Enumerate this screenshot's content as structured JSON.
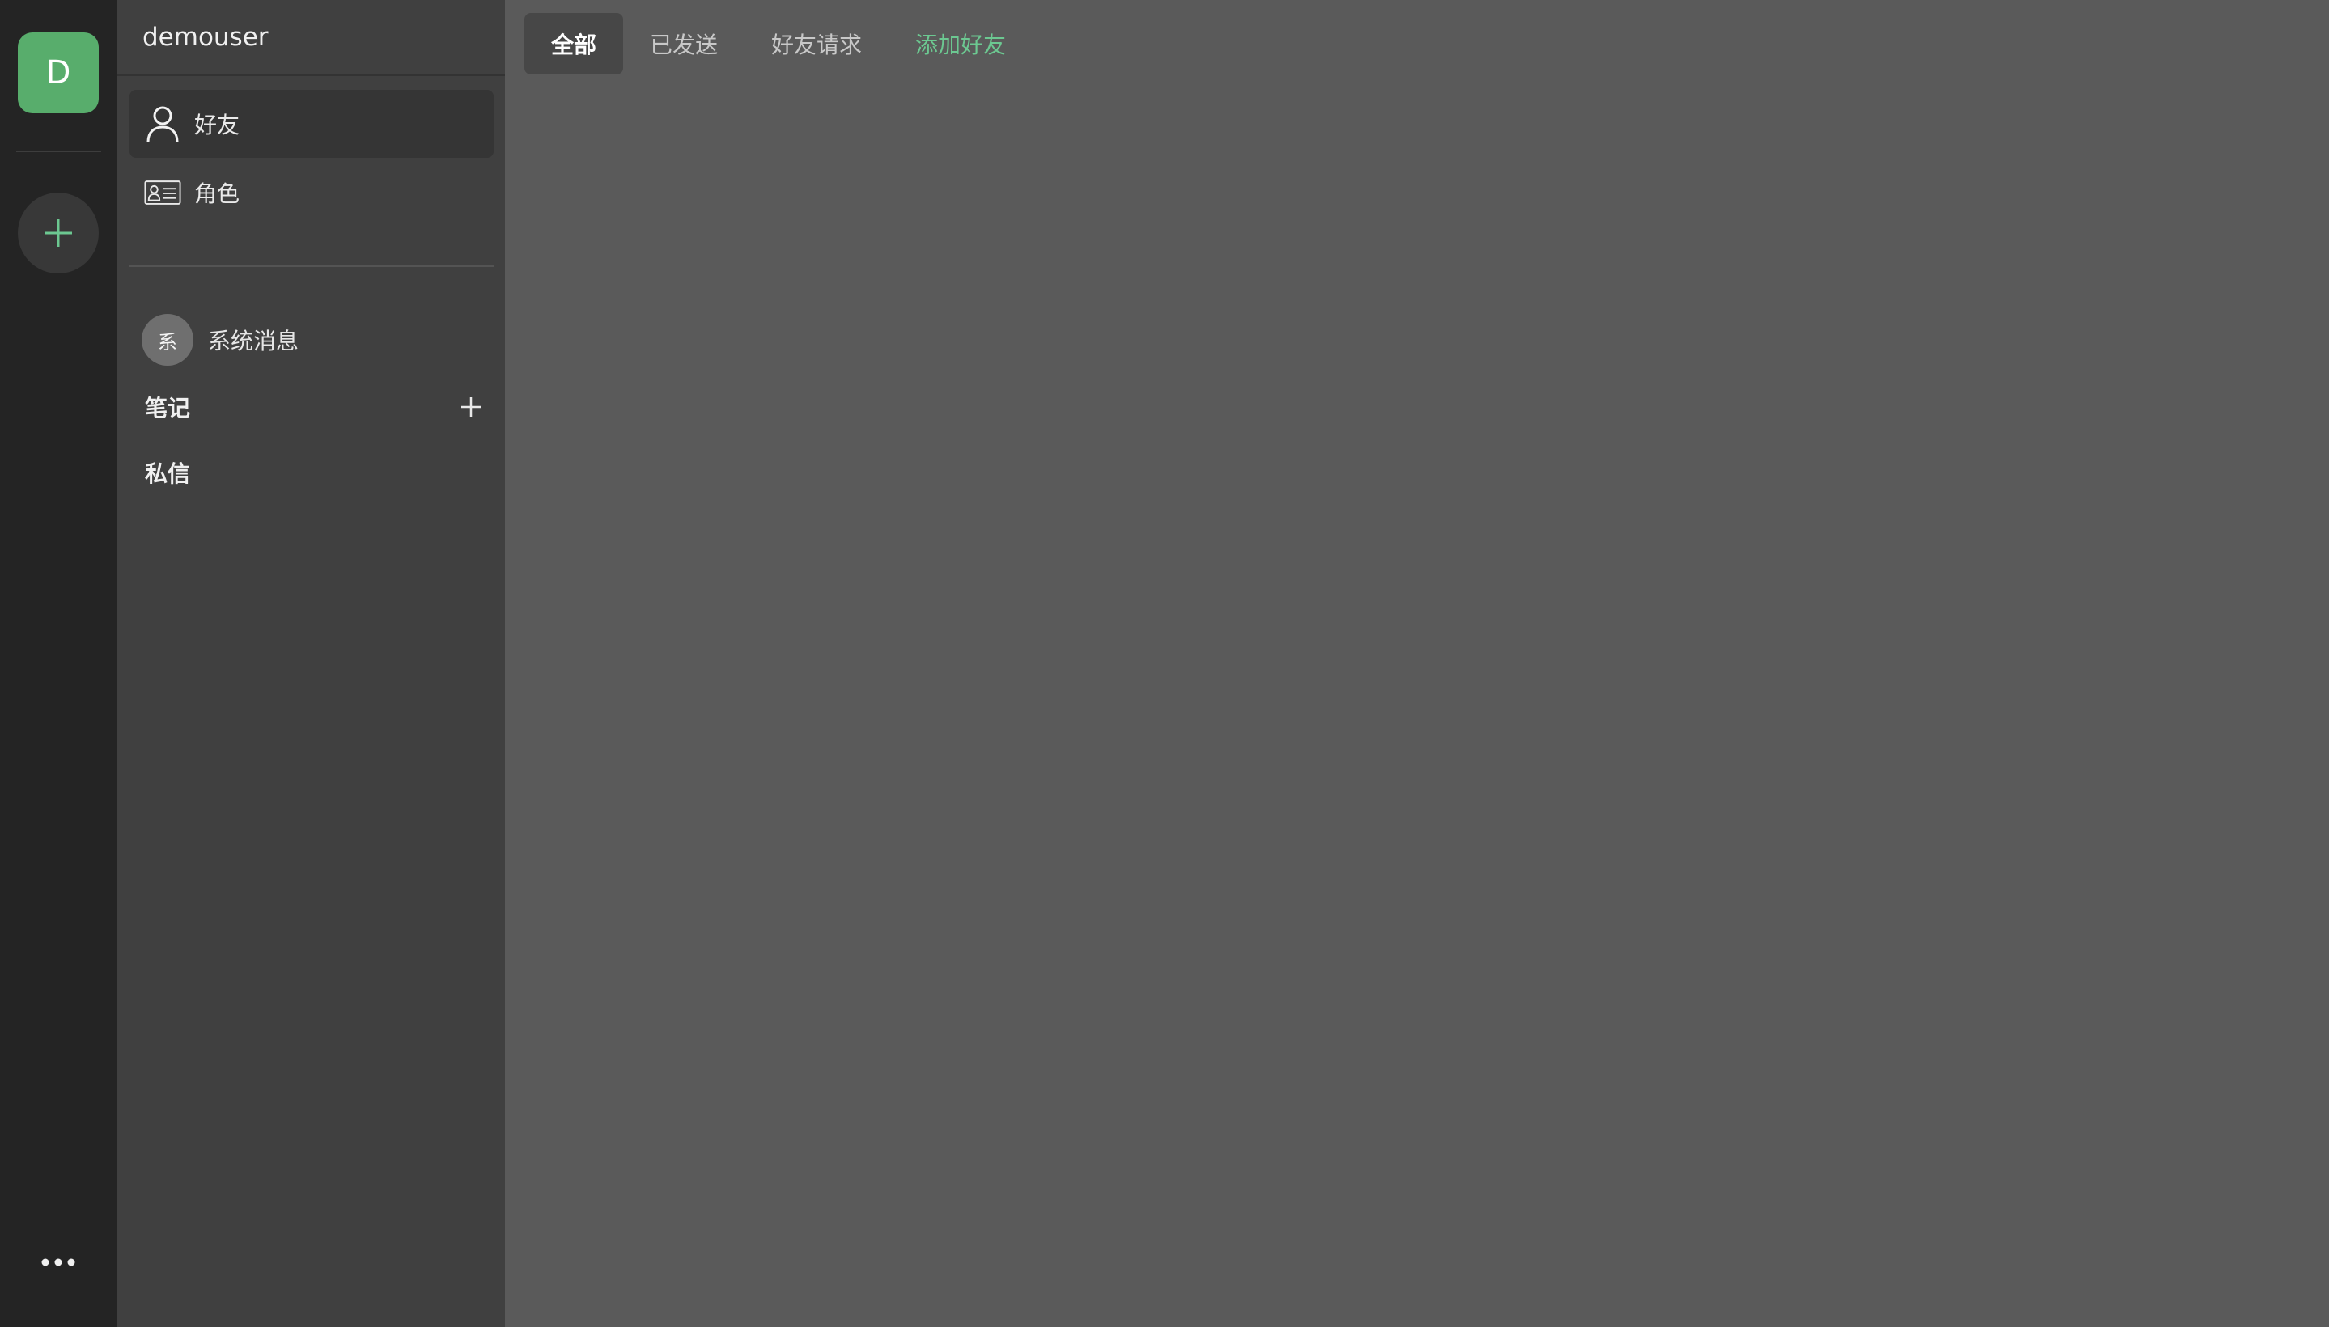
{
  "rail": {
    "avatar_letter": "D",
    "add_icon": "plus-icon",
    "more_icon": "more-dots-icon"
  },
  "sidebar": {
    "username": "demouser",
    "nav": [
      {
        "label": "好友",
        "icon": "user-icon",
        "active": true
      },
      {
        "label": "角色",
        "icon": "id-card-icon",
        "active": false
      }
    ],
    "system_message": {
      "avatar_text": "系",
      "label": "系统消息"
    },
    "sections": [
      {
        "title": "笔记",
        "has_add": true
      },
      {
        "title": "私信",
        "has_add": false
      }
    ]
  },
  "main": {
    "tabs": [
      {
        "label": "全部",
        "active": true
      },
      {
        "label": "已发送",
        "active": false
      },
      {
        "label": "好友请求",
        "active": false
      },
      {
        "label": "添加好友",
        "active": false,
        "accent": true
      }
    ]
  },
  "colors": {
    "accent": "#6cc891",
    "avatar_green": "#58ad6c",
    "rail_bg": "#242424",
    "sidebar_bg": "#404040",
    "main_bg": "#5a5a5a"
  }
}
